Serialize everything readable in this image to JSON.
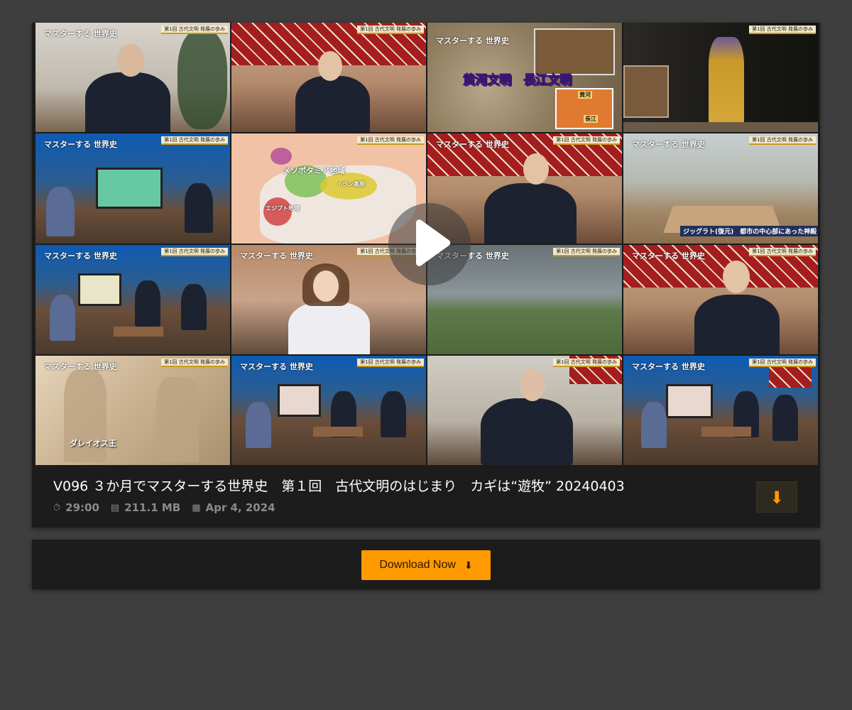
{
  "video": {
    "title": "V096 ３か月でマスターする世界史　第１回　古代文明のはじまり　カギは“遊牧” 20240403",
    "duration": "29:00",
    "size": "211.1 MB",
    "date": "Apr 4, 2024",
    "duration_icon": "clock-icon",
    "size_icon": "file-icon",
    "date_icon": "calendar-icon"
  },
  "thumbnail": {
    "banner": "第1回 古代文明 発展の歩み",
    "logo": "マスターする 世界史",
    "caption_yellow_river": "黄河文明　長江文明",
    "caption_ziggurat": "ジッグラト(復元)　都市の中心部にあった神殿",
    "caption_darius": "ダレイオス王",
    "map_label_mesopotamia": "メソポタミア地域",
    "map_label_iran": "イラン高原",
    "map_label_egypt": "エジプト地域",
    "map_label_yellow": "黄河",
    "map_label_yangtze": "長江"
  },
  "download": {
    "label": "Download Now",
    "icon": "download-icon",
    "accent": "#ff9a00"
  }
}
